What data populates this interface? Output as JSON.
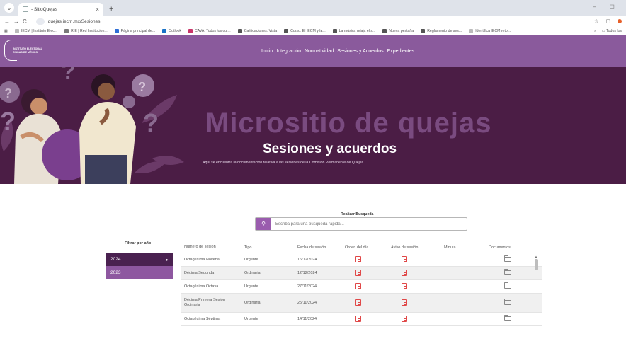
{
  "browser": {
    "tab_title": "- SitioQuejas",
    "url": "quejas.iecm.mx/Sesiones",
    "bookmarks": [
      {
        "label": "IECM | Instituto Elec...",
        "color": "#bbbbbb"
      },
      {
        "label": "RIE | Red Institucion...",
        "color": "#7a7a7a"
      },
      {
        "label": "Página principal de...",
        "color": "#2f6fd6"
      },
      {
        "label": "Outlook",
        "color": "#1a73c8"
      },
      {
        "label": "CAVA: Todos los cur...",
        "color": "#c9366a"
      },
      {
        "label": "Calificaciones: Vista",
        "color": "#555555"
      },
      {
        "label": "Curso: El IECM y la...",
        "color": "#555555"
      },
      {
        "label": "La música relaja el s...",
        "color": "#555555"
      },
      {
        "label": "Nueva pestaña",
        "color": "#555555"
      },
      {
        "label": "Reglamento de ses...",
        "color": "#555555"
      },
      {
        "label": "Identifica IECM reto...",
        "color": "#bbbbbb"
      }
    ],
    "bookmarks_more": "»",
    "all_bookmarks": "Todos los"
  },
  "header": {
    "logo_text_1": "INSTITUTO ELECTORAL",
    "logo_text_2": "CIUDAD DE MÉXICO",
    "nav": [
      "Inicio",
      "Integración",
      "Normatividad",
      "Sesiones y Acuerdos",
      "Expedientes"
    ]
  },
  "hero": {
    "title": "Micrositio de quejas",
    "subtitle": "Sesiones y acuerdos",
    "description": "Aquí se encuentra la documentación relativa a las sesiones de la Comisión Permanente de Quejas"
  },
  "search": {
    "label": "Realizar Busqueda",
    "placeholder": "Escriba para una busqueda rápida..."
  },
  "filter": {
    "label": "Filtrar por año",
    "years": [
      {
        "label": "2024",
        "arrow": "▸"
      },
      {
        "label": "2023",
        "arrow": ""
      }
    ]
  },
  "table": {
    "headers": [
      "Número de sesión",
      "Tipo",
      "Fecha de sesión",
      "Orden del día",
      "Aviso de sesión",
      "Minuta",
      "Documentos"
    ],
    "rows": [
      {
        "numero": "Octagésima Novena",
        "tipo": "Urgente",
        "fecha": "16/12/2024"
      },
      {
        "numero": "Décima Segunda",
        "tipo": "Ordinaria",
        "fecha": "12/12/2024"
      },
      {
        "numero": "Octagésima Octava",
        "tipo": "Urgente",
        "fecha": "27/11/2024"
      },
      {
        "numero": "Décima Primera Sesión Ordinaria",
        "tipo": "Ordinaria",
        "fecha": "25/11/2024"
      },
      {
        "numero": "Octagésima Séptima",
        "tipo": "Urgente",
        "fecha": "14/11/2024"
      }
    ]
  },
  "colors": {
    "brand_purple": "#8a5a9c",
    "hero_background": "#4b1d45",
    "active_year": "#4a2150",
    "pdf_icon": "#e04848"
  }
}
